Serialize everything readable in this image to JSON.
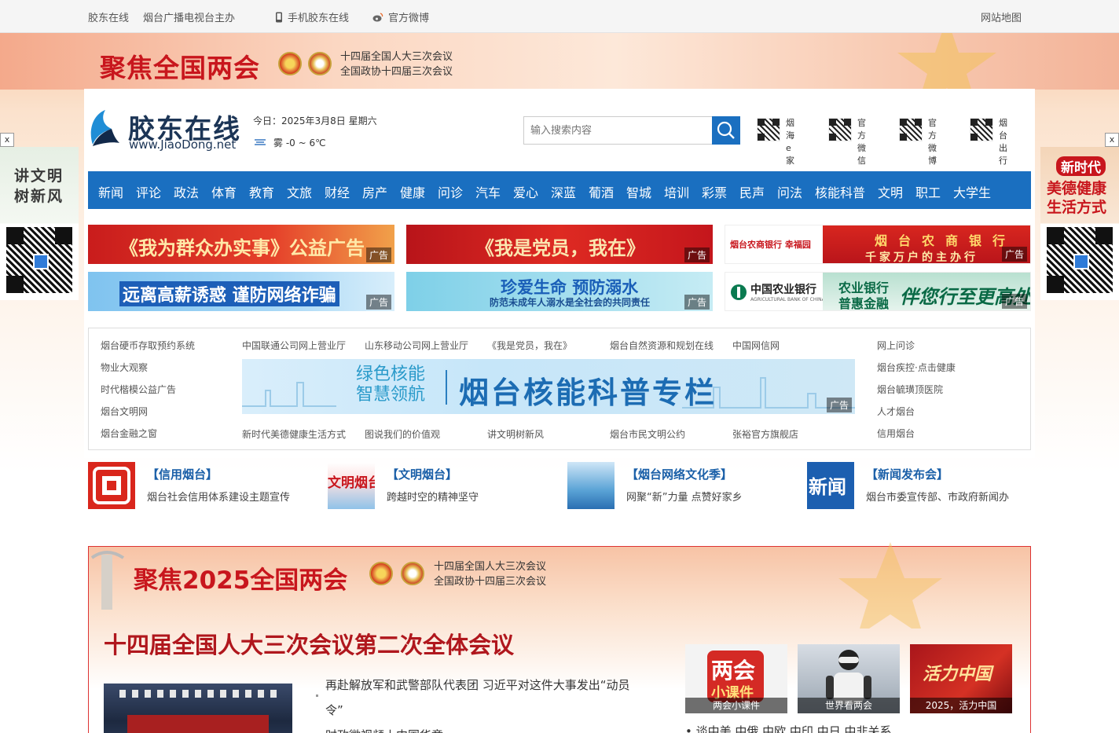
{
  "topbar": {
    "site": "胶东在线",
    "sponsor": "烟台广播电视台主办",
    "mobile": "手机胶东在线",
    "weibo": "官方微博",
    "sitemap": "网站地图"
  },
  "festive_banner": {
    "title": "聚焦全国两会",
    "line1": "十四届全国人大三次会议",
    "line2": "全国政协十四届三次会议"
  },
  "header": {
    "logo_text": "胶东在线",
    "logo_url": "www.JiaoDong.net",
    "date": "今日：2025年3月8日 星期六",
    "weather": "雾 -0 ~ 6℃",
    "search_placeholder": "输入搜索内容",
    "qr_items": [
      {
        "label": "烟海e家"
      },
      {
        "label": "官方微信"
      },
      {
        "label": "官方微博"
      },
      {
        "label": "烟台出行"
      }
    ]
  },
  "nav": [
    "新闻",
    "评论",
    "政法",
    "体育",
    "教育",
    "文旅",
    "财经",
    "房产",
    "健康",
    "问诊",
    "汽车",
    "爱心",
    "深蓝",
    "葡酒",
    "智城",
    "培训",
    "彩票",
    "民声",
    "问法",
    "核能科普",
    "文明",
    "职工",
    "大学生"
  ],
  "ads": {
    "tag": "广告",
    "a1": "《我为群众办实事》公益广告",
    "a2": "《我是党员，我在》",
    "a3_bank": "烟台农商银行 幸福园",
    "a3_slogan": "烟台农商银行",
    "a3_sub": "千家万户的主办行",
    "a4": "远离高薪诱惑 谨防网络诈骗",
    "a5_title": "珍爱生命 预防溺水",
    "a5_sub": "防范未成年人溺水是全社会的共同责任",
    "a6_bank": "中国农业银行",
    "a6_bank_en": "AGRICULTURAL BANK OF CHINA",
    "a6_slogan1": "农业银行",
    "a6_slogan2": "普惠金融",
    "a6_slogan3": "伴您行至更高处"
  },
  "links": {
    "left": [
      "烟台硬币存取预约系统",
      "物业大观察",
      "时代楷模公益广告",
      "烟台文明网",
      "烟台金融之窗"
    ],
    "top": [
      "中国联通公司网上营业厅",
      "山东移动公司网上营业厅",
      "《我是党员，我在》",
      "烟台自然资源和规划在线",
      "中国网信网"
    ],
    "bottom": [
      "新时代美德健康生活方式",
      "图说我们的价值观",
      "讲文明树新风",
      "烟台市民文明公约",
      "张裕官方旗舰店"
    ],
    "right": [
      "网上问诊",
      "烟台疾控·点击健康",
      "烟台毓璜顶医院",
      "人才烟台",
      "信用烟台"
    ],
    "nuclear_a1": "绿色核能",
    "nuclear_a2": "智慧领航",
    "nuclear_b": "烟台核能科普专栏"
  },
  "features": [
    {
      "title": "【信用烟台】",
      "desc": "烟台社会信用体系建设主题宣传"
    },
    {
      "title": "【文明烟台】",
      "desc": "跨越时空的精神坚守",
      "thumb_text": "文明烟台"
    },
    {
      "title": "【烟台网络文化季】",
      "desc": "网聚“新”力量 点赞好家乡"
    },
    {
      "title": "【新闻发布会】",
      "desc": "烟台市委宣传部、市政府新闻办",
      "thumb_text": "新闻"
    }
  ],
  "special": {
    "title": "聚焦2025全国两会",
    "line1": "十四届全国人大三次会议",
    "line2": "全国政协十四届三次会议",
    "headline": "十四届全国人大三次会议第二次全体会议",
    "news1a": "再赴解放军和武警部队代表团 习近平对这件大事发出“动员",
    "news1b": "令”",
    "news2": "时政微视频丨中国华章",
    "thumbs": [
      {
        "caption": "两会小课件",
        "badge": "两会",
        "badge2": "小课件"
      },
      {
        "caption": "世界看两会"
      },
      {
        "caption": "2025，活力中国",
        "badge": "活力中国"
      }
    ],
    "bottom_link": "谈中美 中俄 中欧 中印 中日 中非关系"
  },
  "side_left": {
    "text1": "讲文明",
    "text2": "树新风",
    "close": "x"
  },
  "side_right": {
    "text1": "新时代",
    "text2": "美德健康",
    "text3": "生活方式",
    "close": "x"
  },
  "colors": {
    "brand_blue": "#1a6fc0",
    "festive_red": "#c8161d"
  }
}
